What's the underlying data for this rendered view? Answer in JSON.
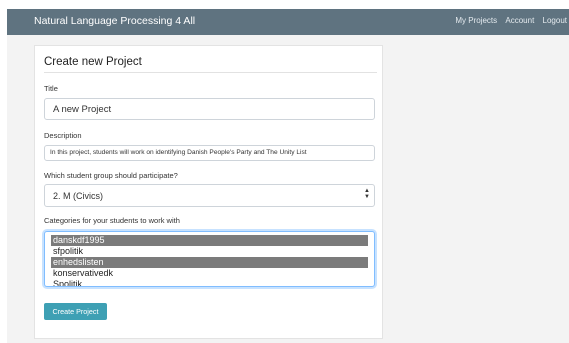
{
  "navbar": {
    "brand": "Natural Language Processing 4 All",
    "links": [
      "My Projects",
      "Account",
      "Logout"
    ]
  },
  "form": {
    "heading": "Create new Project",
    "title_label": "Title",
    "title_value": "A new Project",
    "description_label": "Description",
    "description_value": "In this project, students will work on identifying Danish People's Party and The Unity List",
    "group_label": "Which student group should participate?",
    "group_selected": "2. M (Civics)",
    "categories_label": "Categories for your students to work with",
    "categories": [
      {
        "label": "danskdf1995",
        "selected": true
      },
      {
        "label": "sfpolitik",
        "selected": false
      },
      {
        "label": "enhedslisten",
        "selected": true
      },
      {
        "label": "konservativedk",
        "selected": false
      },
      {
        "label": "Spolitik",
        "selected": false
      }
    ],
    "submit_label": "Create Project"
  },
  "colors": {
    "navbar_bg": "#5f7380",
    "button_bg": "#3ea0b4",
    "selected_option_bg": "#7b7b7b"
  }
}
